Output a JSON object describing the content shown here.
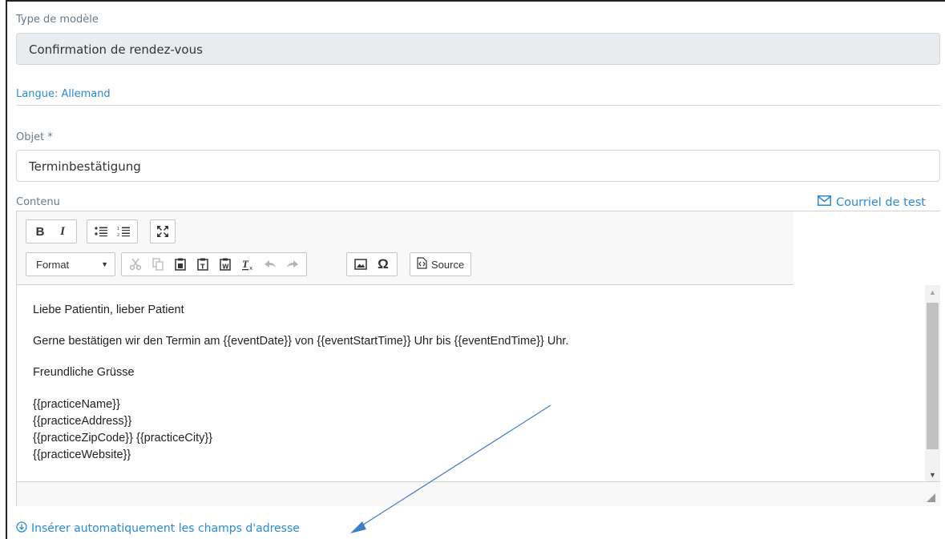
{
  "template_type": {
    "label": "Type de modèle",
    "value": "Confirmation de rendez-vous"
  },
  "language": {
    "label": "Langue: Allemand"
  },
  "subject": {
    "label": "Objet *",
    "value": "Terminbestätigung"
  },
  "content": {
    "label": "Contenu",
    "test_mail_label": "Courriel de test",
    "toolbar": {
      "bold": "B",
      "italic": "I",
      "format_label": "Format",
      "source_label": "Source",
      "icons": [
        "bold-icon",
        "italic-icon",
        "bulleted-list-icon",
        "numbered-list-icon",
        "maximize-icon",
        "cut-icon",
        "copy-icon",
        "paste-icon",
        "paste-text-icon",
        "paste-word-icon",
        "remove-format-icon",
        "undo-icon",
        "redo-icon",
        "image-icon",
        "special-char-icon",
        "source-icon"
      ]
    },
    "body": {
      "greeting": "Liebe Patientin, lieber Patient",
      "line": "Gerne bestätigen wir den Termin am {{eventDate}} von {{eventStartTime}} Uhr bis {{eventEndTime}} Uhr.",
      "closing": "Freundliche Grüsse",
      "signature": [
        "{{practiceName}}",
        "{{practiceAddress}}",
        "{{practiceZipCode}} {{practiceCity}}",
        "{{practiceWebsite}}"
      ]
    }
  },
  "auto_insert": {
    "label": "Insérer automatiquement les champs d'adresse"
  },
  "colors": {
    "accent": "#2a8ad4",
    "readonly_bg": "#e9ecef",
    "arrow": "#3f7fc9"
  }
}
